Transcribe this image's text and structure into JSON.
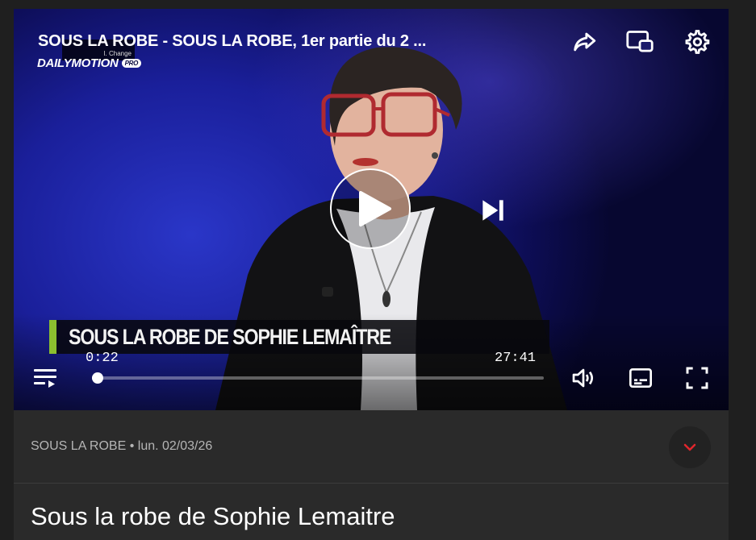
{
  "player": {
    "title": "SOUS LA ROBE - SOUS LA ROBE, 1er partie du 2 ...",
    "corner_badge_text": "l. Change",
    "logo_text": "DAILYMOTION",
    "logo_badge": "PRO",
    "lower_third": "SOUS LA ROBE DE SOPHIE LEMAÎTRE",
    "current_time": "0:22",
    "duration": "27:41",
    "progress": 0.013,
    "icons": {
      "share": "share-icon",
      "cast": "cast-icon",
      "settings": "gear-icon",
      "play": "play-icon",
      "next": "skip-next-icon",
      "playlist": "playlist-icon",
      "volume": "volume-icon",
      "subtitles": "subtitles-icon",
      "fullscreen": "fullscreen-icon"
    },
    "lower_third_accent": "#8bbf2f"
  },
  "info": {
    "meta": "SOUS LA ROBE • lun. 02/03/26",
    "title": "Sous la robe de Sophie Lemaitre",
    "expand_icon": "chevron-down-icon",
    "expand_color": "#e0262c"
  }
}
